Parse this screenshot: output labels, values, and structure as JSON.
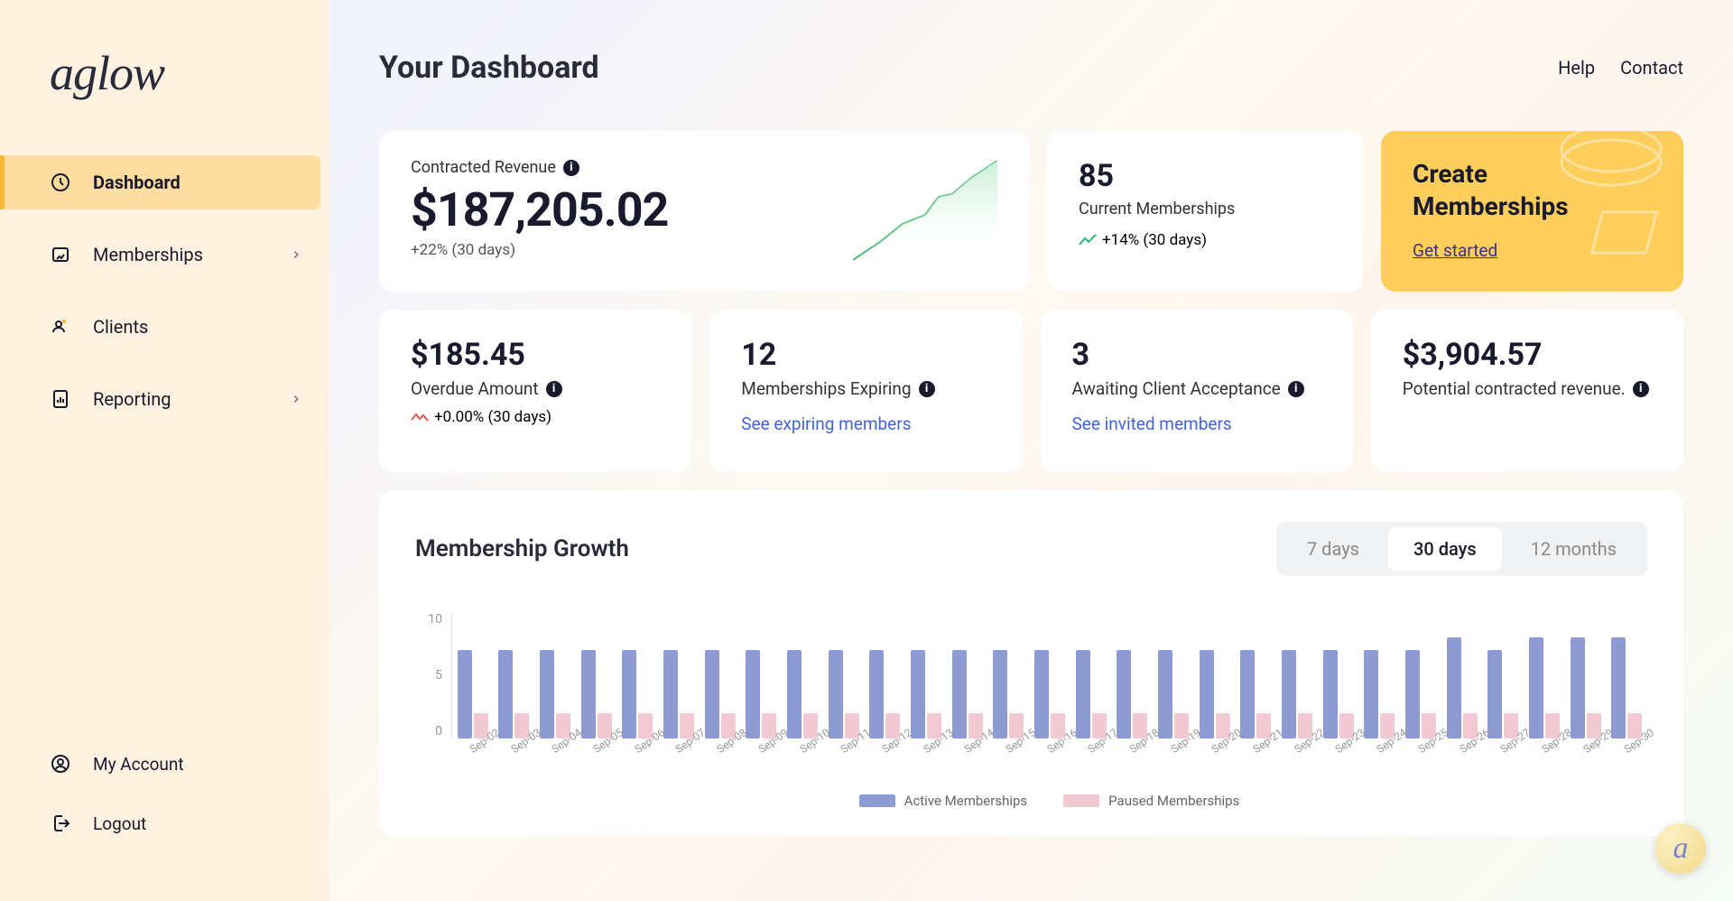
{
  "brand": "aglow",
  "page_title": "Your Dashboard",
  "header_links": {
    "help": "Help",
    "contact": "Contact"
  },
  "sidebar": {
    "items": [
      {
        "label": "Dashboard",
        "active": true,
        "has_sub": false
      },
      {
        "label": "Memberships",
        "active": false,
        "has_sub": true
      },
      {
        "label": "Clients",
        "active": false,
        "has_sub": false
      },
      {
        "label": "Reporting",
        "active": false,
        "has_sub": true
      }
    ],
    "bottom": [
      {
        "label": "My Account"
      },
      {
        "label": "Logout"
      }
    ]
  },
  "cards": {
    "revenue": {
      "label": "Contracted Revenue",
      "value": "$187,205.02",
      "trend": "+22% (30 days)"
    },
    "current": {
      "value": "85",
      "label": "Current Memberships",
      "trend": "+14% (30 days)"
    },
    "cta": {
      "title1": "Create",
      "title2": "Memberships",
      "link": "Get started"
    },
    "overdue": {
      "value": "$185.45",
      "label": "Overdue Amount",
      "trend": "+0.00% (30 days)"
    },
    "expiring": {
      "value": "12",
      "label": "Memberships Expiring",
      "link": "See expiring members"
    },
    "awaiting": {
      "value": "3",
      "label": "Awaiting Client Acceptance",
      "link": "See invited members"
    },
    "potential": {
      "value": "$3,904.57",
      "label": "Potential contracted revenue."
    }
  },
  "chart_title": "Membership Growth",
  "range_buttons": [
    "7 days",
    "30 days",
    "12 months"
  ],
  "range_active": 1,
  "chart_data": {
    "type": "bar",
    "title": "Membership Growth",
    "xlabel": "",
    "ylabel": "",
    "ylim": [
      0,
      10
    ],
    "yticks": [
      0,
      5,
      10
    ],
    "categories": [
      "Sep-02",
      "Sep-03",
      "Sep-04",
      "Sep-05",
      "Sep-06",
      "Sep-07",
      "Sep-08",
      "Sep-09",
      "Sep-10",
      "Sep-11",
      "Sep-12",
      "Sep-13",
      "Sep-14",
      "Sep-15",
      "Sep-16",
      "Sep-17",
      "Sep-18",
      "Sep-19",
      "Sep-20",
      "Sep-21",
      "Sep-22",
      "Sep-23",
      "Sep-24",
      "Sep-25",
      "Sep-26",
      "Sep-27",
      "Sep-28",
      "Sep-29",
      "Sep-30"
    ],
    "series": [
      {
        "name": "Active Memberships",
        "color": "#8e9bd2",
        "values": [
          7,
          7,
          7,
          7,
          7,
          7,
          7,
          7,
          7,
          7,
          7,
          7,
          7,
          7,
          7,
          7,
          7,
          7,
          7,
          7,
          7,
          7,
          7,
          7,
          8,
          7,
          8,
          8,
          8
        ]
      },
      {
        "name": "Paused Memberships",
        "color": "#f0c9d2",
        "values": [
          2,
          2,
          2,
          2,
          2,
          2,
          2,
          2,
          2,
          2,
          2,
          2,
          2,
          2,
          2,
          2,
          2,
          2,
          2,
          2,
          2,
          2,
          2,
          2,
          2,
          2,
          2,
          2,
          2
        ]
      }
    ],
    "legend_position": "bottom"
  }
}
